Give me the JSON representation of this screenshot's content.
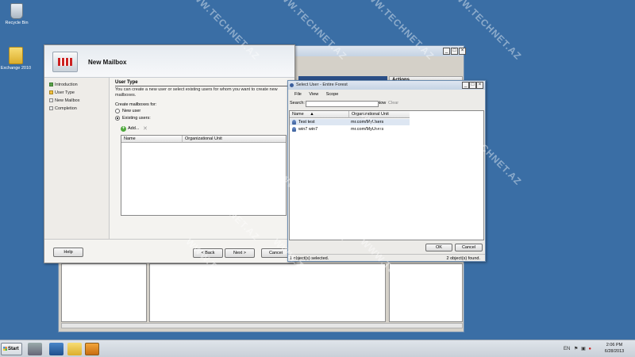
{
  "desktop": {
    "icons": [
      {
        "label": "Recycle Bin"
      },
      {
        "label": "Exchange 2010"
      }
    ]
  },
  "console": {
    "actions_header": "Actions"
  },
  "wizard": {
    "title": "New Mailbox",
    "steps": [
      "Introduction",
      "User Type",
      "New Mailbox",
      "Completion"
    ],
    "current_step": "User Type",
    "section_title": "User Type",
    "description": "You can create a new user or select existing users for whom you want to create new mailboxes.",
    "create_for_label": "Create mailboxes for:",
    "options": [
      "New user",
      "Existing users:"
    ],
    "selected_option": "Existing users:",
    "add_label": "Add...",
    "columns": [
      "Name",
      "Organizational Unit"
    ],
    "help_label": "Help",
    "back_label": "< Back",
    "next_label": "Next >",
    "cancel_label": "Cancel"
  },
  "select_user": {
    "title": "Select User - Entire Forest",
    "menu": [
      "File",
      "View",
      "Scope"
    ],
    "search_label": "Search:",
    "find_now_label": "Find Now",
    "clear_label": "Clear",
    "columns": [
      "Name",
      "Organizational Unit"
    ],
    "rows": [
      {
        "name": "Test test",
        "ou": "mr.com/MyUsers",
        "selected": true
      },
      {
        "name": "win7 win7",
        "ou": "mr.com/MyUsers",
        "selected": false
      }
    ],
    "ok_label": "OK",
    "cancel_label": "Cancel",
    "status_left": "1 object(s) selected.",
    "status_right": "2 object(s) found."
  },
  "taskbar": {
    "start_label": "Start",
    "time": "2:06 PM",
    "date": "6/28/2013",
    "tray_text": "EN"
  },
  "watermark": "WWW.TECHNET.AZ",
  "colors": {
    "desktop": "#3a6ea5",
    "selected_row": "#dde6f2",
    "step_done": "#5aa04a",
    "step_current": "#f0c040"
  }
}
